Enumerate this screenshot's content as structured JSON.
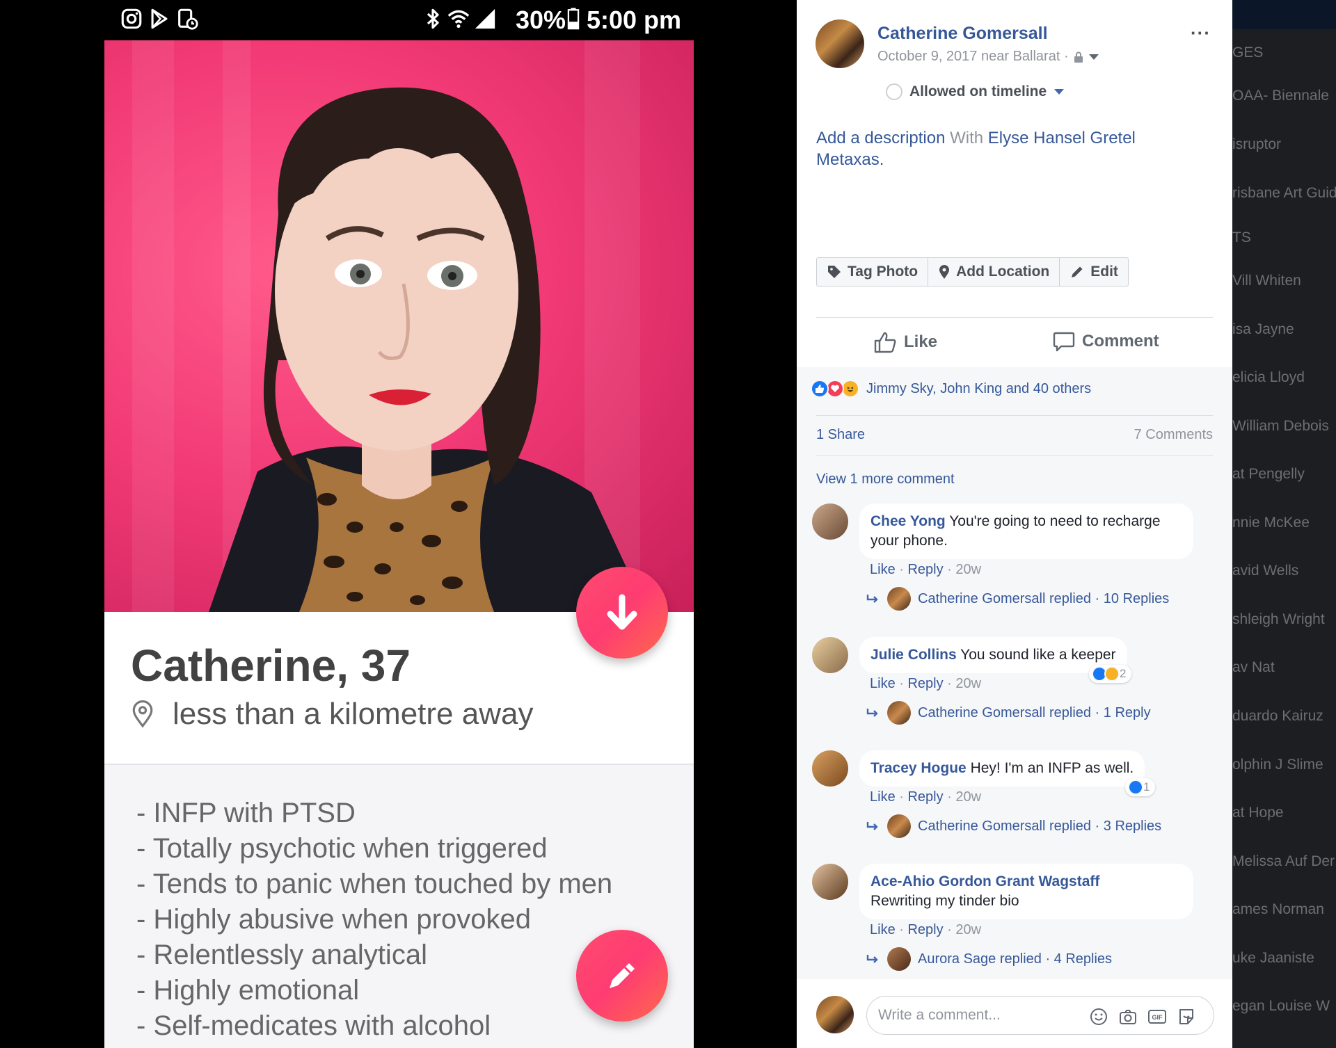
{
  "status_bar": {
    "icons": [
      "instagram-icon",
      "play-store-icon",
      "sync-icon",
      "bluetooth-icon",
      "wifi-icon",
      "signal-icon",
      "battery-icon"
    ],
    "battery": "30%",
    "time": "5:00 pm"
  },
  "tinder": {
    "name_age": "Catherine, 37",
    "distance": "less than a kilometre away",
    "accent_color": "#fe3c72",
    "bio": [
      "- INFP with PTSD",
      "- Totally psychotic when triggered",
      "- Tends to panic when touched by men",
      "- Highly abusive when provoked",
      "- Relentlessly analytical",
      "- Highly emotional",
      "- Self-medicates with alcohol"
    ]
  },
  "facebook": {
    "poster": "Catherine Gomersall",
    "date_location": "October 9, 2017 near Ballarat ·",
    "more": "···",
    "timeline": "Allowed on timeline",
    "description": {
      "add": "Add a description",
      "with": " With ",
      "tagged": "Elyse Hansel Gretel Metaxas",
      "end": "."
    },
    "photo_actions": {
      "tag": "Tag Photo",
      "location": "Add Location",
      "edit": "Edit"
    },
    "actions": {
      "like": "Like",
      "comment": "Comment"
    },
    "reactions_text": "Jimmy Sky, John King and 40 others",
    "shares": "1 Share",
    "comments_count": "7 Comments",
    "view_more": "View 1 more comment",
    "comments": [
      {
        "author": "Chee Yong",
        "text": " You're going to need to recharge your phone.",
        "like": "Like",
        "reply": "Reply",
        "time": "20w",
        "replies": "Catherine Gomersall replied · 10 Replies"
      },
      {
        "author": "Julie Collins",
        "text": " You sound like a keeper",
        "like": "Like",
        "reply": "Reply",
        "time": "20w",
        "reaction_count": "2",
        "replies": "Catherine Gomersall replied · 1 Reply"
      },
      {
        "author": "Tracey Hogue",
        "text": " Hey! I'm an INFP as well.",
        "like": "Like",
        "reply": "Reply",
        "time": "20w",
        "reaction_count": "1",
        "replies": "Catherine Gomersall replied · 3 Replies"
      },
      {
        "author": "Ace-Ahio Gordon Grant Wagstaff",
        "text": "Rewriting my tinder bio",
        "like": "Like",
        "reply": "Reply",
        "time": "20w",
        "replies": "Aurora Sage replied · 4 Replies"
      }
    ],
    "write_placeholder": "Write a comment...",
    "link_color": "#365899"
  },
  "background_sidebar": {
    "items": [
      "GES",
      "OAA- Biennale",
      "isruptor",
      "risbane Art Guid",
      "TS",
      "Vill Whiten",
      "isa Jayne",
      "elicia Lloyd",
      "William Debois",
      "at Pengelly",
      "nnie McKee",
      "avid Wells",
      "shleigh Wright",
      "av Nat",
      "duardo Kairuz",
      "olphin J Slime",
      "at Hope",
      "Melissa Auf Der",
      "ames Norman",
      "uke Jaaniste",
      "egan Louise W"
    ]
  }
}
